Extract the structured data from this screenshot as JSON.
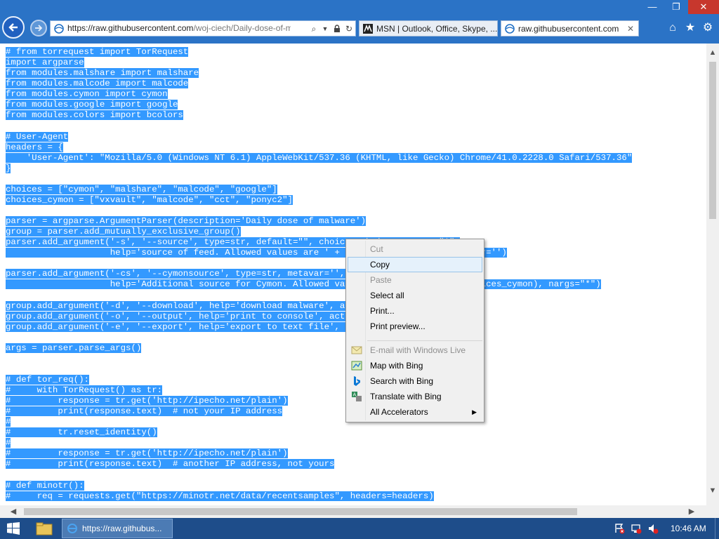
{
  "window": {
    "min_label": "—",
    "max_label": "❐",
    "close_label": "✕"
  },
  "address_bar": {
    "url_main": "https://raw.githubusercontent.com",
    "url_rest": "/woj-ciech/Daily-dose-of-ma"
  },
  "tabs": [
    {
      "label": "MSN | Outlook, Office, Skype, ..."
    },
    {
      "label": "raw.githubusercontent.com",
      "close": "✕"
    }
  ],
  "toolbar": {
    "home_icon": "⌂",
    "star_icon": "★",
    "gear_icon": "⚙"
  },
  "code_lines": [
    "# from torrequest import TorRequest",
    "import argparse",
    "from modules.malshare import malshare",
    "from modules.malcode import malcode",
    "from modules.cymon import cymon",
    "from modules.google import google",
    "from modules.colors import bcolors",
    "",
    "# User-Agent",
    "headers = {",
    "    'User-Agent': \"Mozilla/5.0 (Windows NT 6.1) AppleWebKit/537.36 (KHTML, like Gecko) Chrome/41.0.2228.0 Safari/537.36\"",
    "}",
    "",
    "choices = [\"cymon\", \"malshare\", \"malcode\", \"google\"]",
    "choices_cymon = [\"vxvault\", \"malcode\", \"cct\", \"ponyc2\"]",
    "",
    "parser = argparse.ArgumentParser(description='Daily dose of malware')",
    "group = parser.add_mutually_exclusive_group()",
    "parser.add_argument('-s', '--source', type=str, default=\"\", choices=choices, nargs=\"*\",",
    "                    help='source of feed. Allowed values are ' + ', '.join(choices), metavar='')",
    "",
    "parser.add_argument('-cs', '--cymonsource', type=str, metavar='', choices=choices_cymon,",
    "                    help='Additional source for Cymon. Allowed values are ' + ', '.join(choices_cymon), nargs=\"*\")",
    "",
    "group.add_argument('-d', '--download', help='download malware', action='store_true')",
    "group.add_argument('-o', '--output', help='print to console', action='store_true')",
    "group.add_argument('-e', '--export', help='export to text file', action='store_true')",
    "",
    "args = parser.parse_args()",
    "",
    "",
    "# def tor_req():",
    "#     with TorRequest() as tr:",
    "#         response = tr.get('http://ipecho.net/plain')",
    "#         print(response.text)  # not your IP address",
    "#",
    "#         tr.reset_identity()",
    "#",
    "#         response = tr.get('http://ipecho.net/plain')",
    "#         print(response.text)  # another IP address, not yours",
    "",
    "# def minotr():",
    "#     req = requests.get(\"https://minotr.net/data/recentsamples\", headers=headers)"
  ],
  "context_menu": {
    "items": [
      {
        "label": "Cut",
        "disabled": true
      },
      {
        "label": "Copy",
        "highlighted": true
      },
      {
        "label": "Paste",
        "disabled": true
      },
      {
        "label": "Select all"
      },
      {
        "label": "Print..."
      },
      {
        "label": "Print preview..."
      },
      {
        "label": "E-mail with Windows Live",
        "disabled": true,
        "icon": "windows-live-icon"
      },
      {
        "label": "Map with Bing",
        "icon": "map-icon"
      },
      {
        "label": "Search with Bing",
        "icon": "bing-icon"
      },
      {
        "label": "Translate with Bing",
        "icon": "translate-icon"
      },
      {
        "label": "All Accelerators",
        "submenu": true
      }
    ]
  },
  "scrollbars": {
    "up": "▲",
    "down": "▼",
    "left": "◀",
    "right": "▶"
  },
  "taskbar": {
    "ie_label": "https://raw.githubus...",
    "clock": "10:46 AM"
  },
  "colors": {
    "selection": "#3399ff",
    "chrome": "#2b73c6",
    "taskbar": "#1e4d8a"
  }
}
